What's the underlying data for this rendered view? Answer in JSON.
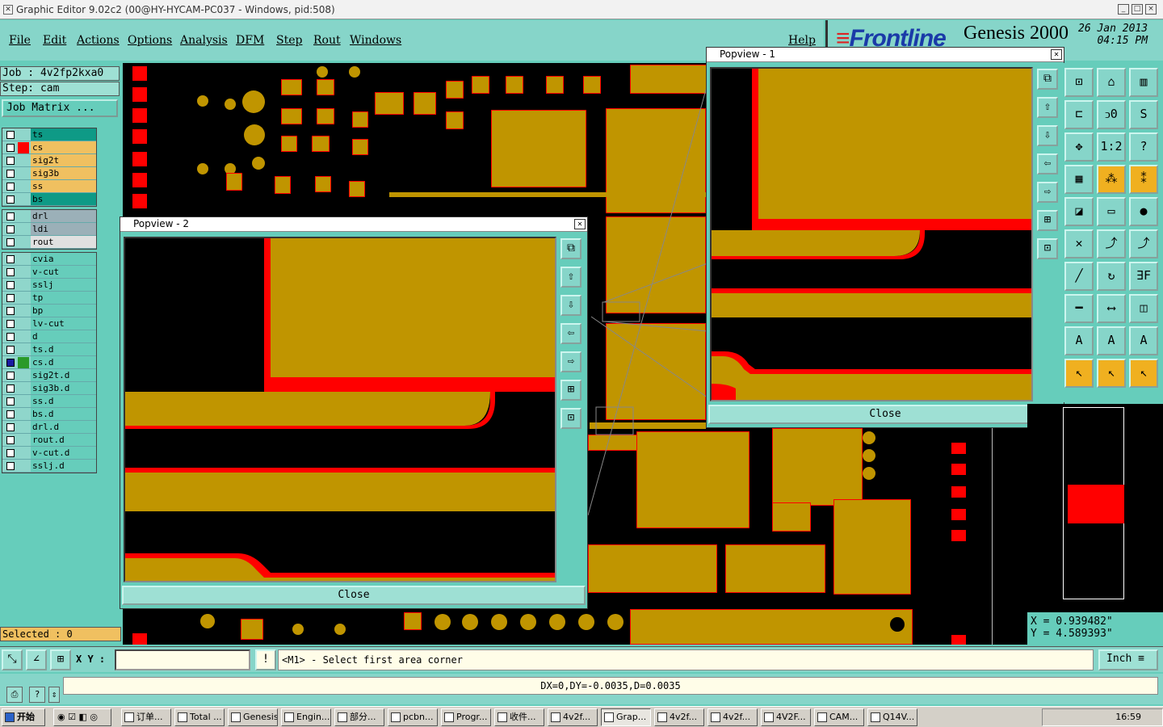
{
  "window": {
    "title": "Graphic Editor 9.02c2 (00@HY-HYCAM-PC037 - Windows, pid:508)",
    "min_label": "_",
    "max_label": "□",
    "close_label": "×"
  },
  "menu": {
    "file": "File",
    "edit": "Edit",
    "actions": "Actions",
    "options": "Options",
    "analysis": "Analysis",
    "dfm": "DFM",
    "step": "Step",
    "rout": "Rout",
    "windows": "Windows",
    "help": "Help"
  },
  "brand": {
    "logo": "Frontline",
    "product": "Genesis 2000",
    "date": "26 Jan 2013",
    "time": "04:15 PM"
  },
  "job": {
    "job_label": "Job : 4v2fp2kxa0",
    "step_label": "Step: cam",
    "matrix_button": "Job Matrix ..."
  },
  "layers_group1": [
    {
      "name": "ts",
      "color": "#0e9a86",
      "swatch": ""
    },
    {
      "name": "cs",
      "color": "#f0c060",
      "swatch": "#ff0000"
    },
    {
      "name": "sig2t",
      "color": "#f0c060",
      "swatch": ""
    },
    {
      "name": "sig3b",
      "color": "#f0c060",
      "swatch": ""
    },
    {
      "name": "ss",
      "color": "#f0c060",
      "swatch": ""
    },
    {
      "name": "bs",
      "color": "#0e9a86",
      "swatch": ""
    }
  ],
  "layers_group2": [
    {
      "name": "drl",
      "color": "#9bb0b8",
      "swatch": ""
    },
    {
      "name": "ldi",
      "color": "#9bb0b8",
      "swatch": ""
    },
    {
      "name": "rout",
      "color": "#e0e0e0",
      "swatch": ""
    }
  ],
  "layers_group3": [
    {
      "name": "cvia",
      "color": "#66cdbb",
      "swatch": ""
    },
    {
      "name": "v-cut",
      "color": "#66cdbb",
      "swatch": ""
    },
    {
      "name": "sslj",
      "color": "#66cdbb",
      "swatch": ""
    },
    {
      "name": "tp",
      "color": "#66cdbb",
      "swatch": ""
    },
    {
      "name": "bp",
      "color": "#66cdbb",
      "swatch": ""
    },
    {
      "name": "lv-cut",
      "color": "#66cdbb",
      "swatch": ""
    },
    {
      "name": "d",
      "color": "#66cdbb",
      "swatch": ""
    },
    {
      "name": "ts.d",
      "color": "#66cdbb",
      "swatch": ""
    },
    {
      "name": "cs.d",
      "color": "#66cdbb",
      "swatch": "#2a9a2a",
      "active": true
    },
    {
      "name": "sig2t.d",
      "color": "#66cdbb",
      "swatch": ""
    },
    {
      "name": "sig3b.d",
      "color": "#66cdbb",
      "swatch": ""
    },
    {
      "name": "ss.d",
      "color": "#66cdbb",
      "swatch": ""
    },
    {
      "name": "bs.d",
      "color": "#66cdbb",
      "swatch": ""
    },
    {
      "name": "drl.d",
      "color": "#66cdbb",
      "swatch": ""
    },
    {
      "name": "rout.d",
      "color": "#66cdbb",
      "swatch": ""
    },
    {
      "name": "v-cut.d",
      "color": "#66cdbb",
      "swatch": ""
    },
    {
      "name": "sslj.d",
      "color": "#66cdbb",
      "swatch": ""
    }
  ],
  "selected": "Selected : 0",
  "popview1": {
    "title": "Popview - 1",
    "close": "Close"
  },
  "popview2": {
    "title": "Popview - 2",
    "close": "Close"
  },
  "coords": {
    "x": "X = 0.939482\"",
    "y": "Y = 4.589393\""
  },
  "command": {
    "xy_label": "X Y :",
    "xy_value": "",
    "prompt": "<M1> - Select first area corner",
    "units": "Inch"
  },
  "status": {
    "delta": "DX=0,DY=-0.0035,D=0.0035"
  },
  "taskbar": {
    "start": "开始",
    "items": [
      "订单...",
      "Total ...",
      "Genesis",
      "Engin...",
      "部分...",
      "pcbn...",
      "Progr...",
      "收件...",
      "4v2f...",
      "Grap...",
      "4v2f...",
      "4v2f...",
      "4V2F...",
      "CAM...",
      "Q14V..."
    ],
    "clock": "16:59"
  }
}
